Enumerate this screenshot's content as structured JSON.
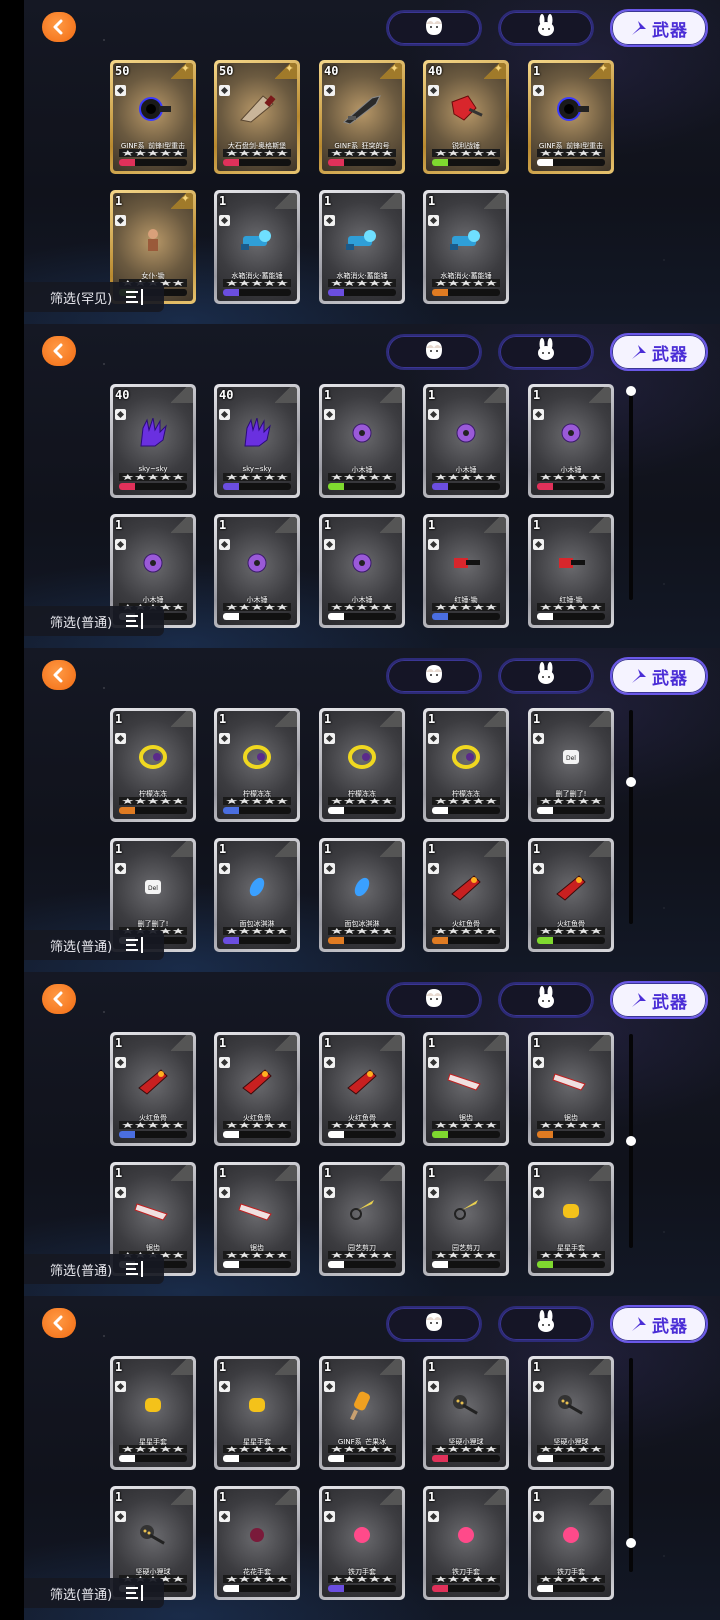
{
  "tabs": {
    "face_icon": "face-icon",
    "bunny_icon": "bunny-icon",
    "weapon_label": "武器"
  },
  "colors": {
    "accent": "#4b2ed6",
    "back": "#f26b12"
  },
  "panels": [
    {
      "filter_label": "筛选(罕见)",
      "scroll": null,
      "cards": [
        {
          "frame": "gold",
          "level": "50",
          "name": "GINF系_前锋I型重击",
          "bar": "#e0315a",
          "art": "ring"
        },
        {
          "frame": "gold",
          "level": "50",
          "name": "大石盘剑·奥格斯堡",
          "bar": "#e0315a",
          "art": "cleaver"
        },
        {
          "frame": "gold",
          "level": "40",
          "name": "GINF系_狂突的号",
          "bar": "#e0315a",
          "art": "blade"
        },
        {
          "frame": "gold",
          "level": "40",
          "name": "锐利战锤",
          "bar": "#7fd92f",
          "art": "redaxe"
        },
        {
          "frame": "gold",
          "level": "1",
          "name": "GINF系_前锋I型重击",
          "bar": "#ffffff",
          "art": "ring"
        },
        {
          "frame": "gold",
          "level": "1",
          "name": "女仆·锄",
          "bar": "#7fd92f",
          "art": "doll"
        },
        {
          "frame": "silver",
          "level": "1",
          "name": "水箱消火·蓄能锤",
          "bar": "#6b4ee0",
          "art": "bluegun"
        },
        {
          "frame": "silver",
          "level": "1",
          "name": "水箱消火·蓄能锤",
          "bar": "#6b4ee0",
          "art": "bluegun"
        },
        {
          "frame": "silver",
          "level": "1",
          "name": "水箱消火·蓄能锤",
          "bar": "#e07b22",
          "art": "bluegun"
        }
      ]
    },
    {
      "filter_label": "筛选(普通)",
      "scroll": 0.0,
      "cards": [
        {
          "frame": "silver",
          "level": "40",
          "name": "sky~sky",
          "bar": "#e0315a",
          "art": "glove"
        },
        {
          "frame": "silver",
          "level": "40",
          "name": "sky~sky",
          "bar": "#6b4ee0",
          "art": "glove"
        },
        {
          "frame": "silver",
          "level": "1",
          "name": "小木锤",
          "bar": "#7fd92f",
          "art": "purpleorb"
        },
        {
          "frame": "silver",
          "level": "1",
          "name": "小木锤",
          "bar": "#6b4ee0",
          "art": "purpleorb"
        },
        {
          "frame": "silver",
          "level": "1",
          "name": "小木锤",
          "bar": "#e0315a",
          "art": "purpleorb"
        },
        {
          "frame": "silver",
          "level": "1",
          "name": "小木锤",
          "bar": "#ffffff",
          "art": "purpleorb"
        },
        {
          "frame": "silver",
          "level": "1",
          "name": "小木锤",
          "bar": "#ffffff",
          "art": "purpleorb"
        },
        {
          "frame": "silver",
          "level": "1",
          "name": "小木锤",
          "bar": "#ffffff",
          "art": "purpleorb"
        },
        {
          "frame": "silver",
          "level": "1",
          "name": "红锤·锄",
          "bar": "#4a6ee0",
          "art": "redhammer"
        },
        {
          "frame": "silver",
          "level": "1",
          "name": "红锤·锄",
          "bar": "#ffffff",
          "art": "redhammer"
        }
      ]
    },
    {
      "filter_label": "筛选(普通)",
      "scroll": 0.33,
      "cards": [
        {
          "frame": "silver",
          "level": "1",
          "name": "柠檬冻冻",
          "bar": "#e07b22",
          "art": "yellowring"
        },
        {
          "frame": "silver",
          "level": "1",
          "name": "柠檬冻冻",
          "bar": "#4a6ee0",
          "art": "yellowring"
        },
        {
          "frame": "silver",
          "level": "1",
          "name": "柠檬冻冻",
          "bar": "#ffffff",
          "art": "yellowring"
        },
        {
          "frame": "silver",
          "level": "1",
          "name": "柠檬冻冻",
          "bar": "#ffffff",
          "art": "yellowring"
        },
        {
          "frame": "silver",
          "level": "1",
          "name": "删了删了!",
          "bar": "#ffffff",
          "art": "delkey"
        },
        {
          "frame": "silver",
          "level": "1",
          "name": "删了删了!",
          "bar": "#ffffff",
          "art": "delkey"
        },
        {
          "frame": "silver",
          "level": "1",
          "name": "面包冰淇淋",
          "bar": "#6b4ee0",
          "art": "bluecrystal"
        },
        {
          "frame": "silver",
          "level": "1",
          "name": "面包冰淇淋",
          "bar": "#e07b22",
          "art": "bluecrystal"
        },
        {
          "frame": "silver",
          "level": "1",
          "name": "火红鱼骨",
          "bar": "#e07b22",
          "art": "fishbone"
        },
        {
          "frame": "silver",
          "level": "1",
          "name": "火红鱼骨",
          "bar": "#7fd92f",
          "art": "fishbone"
        }
      ]
    },
    {
      "filter_label": "筛选(普通)",
      "scroll": 0.5,
      "cards": [
        {
          "frame": "silver",
          "level": "1",
          "name": "火红鱼骨",
          "bar": "#4a6ee0",
          "art": "fishbone"
        },
        {
          "frame": "silver",
          "level": "1",
          "name": "火红鱼骨",
          "bar": "#ffffff",
          "art": "fishbone"
        },
        {
          "frame": "silver",
          "level": "1",
          "name": "火红鱼骨",
          "bar": "#ffffff",
          "art": "fishbone"
        },
        {
          "frame": "silver",
          "level": "1",
          "name": "锯齿",
          "bar": "#7fd92f",
          "art": "saw"
        },
        {
          "frame": "silver",
          "level": "1",
          "name": "锯齿",
          "bar": "#e07b22",
          "art": "saw"
        },
        {
          "frame": "silver",
          "level": "1",
          "name": "锯齿",
          "bar": "#ffffff",
          "art": "saw"
        },
        {
          "frame": "silver",
          "level": "1",
          "name": "锯齿",
          "bar": "#ffffff",
          "art": "saw"
        },
        {
          "frame": "silver",
          "level": "1",
          "name": "园艺剪刀",
          "bar": "#ffffff",
          "art": "scissors"
        },
        {
          "frame": "silver",
          "level": "1",
          "name": "园艺剪刀",
          "bar": "#ffffff",
          "art": "scissors"
        },
        {
          "frame": "silver",
          "level": "1",
          "name": "星星手套",
          "bar": "#7fd92f",
          "art": "yellowglove"
        }
      ]
    },
    {
      "filter_label": "筛选(普通)",
      "scroll": 0.88,
      "cards": [
        {
          "frame": "silver",
          "level": "1",
          "name": "星星手套",
          "bar": "#ffffff",
          "art": "yellowglove"
        },
        {
          "frame": "silver",
          "level": "1",
          "name": "星星手套",
          "bar": "#ffffff",
          "art": "yellowglove"
        },
        {
          "frame": "silver",
          "level": "1",
          "name": "GINF系_芒果冰",
          "bar": "#ffffff",
          "art": "icecream"
        },
        {
          "frame": "silver",
          "level": "1",
          "name": "坚硬小狸球",
          "bar": "#e0315a",
          "art": "paw"
        },
        {
          "frame": "silver",
          "level": "1",
          "name": "坚硬小狸球",
          "bar": "#ffffff",
          "art": "paw"
        },
        {
          "frame": "silver",
          "level": "1",
          "name": "坚硬小狸球",
          "bar": "#ffffff",
          "art": "paw"
        },
        {
          "frame": "silver",
          "level": "1",
          "name": "花花手套",
          "bar": "#ffffff",
          "art": "darkglove"
        },
        {
          "frame": "silver",
          "level": "1",
          "name": "铁刀手套",
          "bar": "#6b4ee0",
          "art": "pinkglove"
        },
        {
          "frame": "silver",
          "level": "1",
          "name": "铁刀手套",
          "bar": "#e0315a",
          "art": "pinkglove"
        },
        {
          "frame": "silver",
          "level": "1",
          "name": "铁刀手套",
          "bar": "#ffffff",
          "art": "pinkglove"
        }
      ]
    }
  ]
}
